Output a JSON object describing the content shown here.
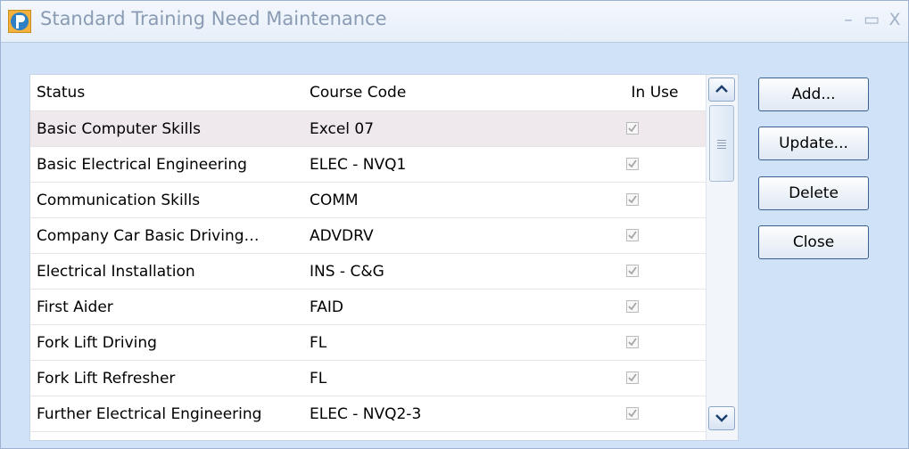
{
  "window": {
    "title": "Standard Training Need Maintenance",
    "icon": "app-logo-icon",
    "controls": [
      "minimize-icon",
      "maximize-icon",
      "close-icon"
    ]
  },
  "table": {
    "columns": {
      "status": "Status",
      "code": "Course Code",
      "inuse": "In Use"
    },
    "rows": [
      {
        "status": "Basic Computer Skills",
        "code": "Excel 07",
        "in_use": true
      },
      {
        "status": "Basic Electrical Engineering",
        "code": "ELEC - NVQ1",
        "in_use": true
      },
      {
        "status": "Communication Skills",
        "code": "COMM",
        "in_use": true
      },
      {
        "status": "Company Car Basic Driving…",
        "code": "ADVDRV",
        "in_use": true
      },
      {
        "status": "Electrical Installation",
        "code": "INS - C&G",
        "in_use": true
      },
      {
        "status": "First Aider",
        "code": "FAID",
        "in_use": true
      },
      {
        "status": "Fork Lift Driving",
        "code": "FL",
        "in_use": true
      },
      {
        "status": "Fork Lift Refresher",
        "code": "FL",
        "in_use": true
      },
      {
        "status": "Further Electrical Engineering",
        "code": "ELEC - NVQ2-3",
        "in_use": true
      }
    ],
    "selected_row": 0
  },
  "buttons": {
    "add": "Add...",
    "update": "Update...",
    "delete": "Delete",
    "close": "Close"
  },
  "colors": {
    "window_bg": "#cfe2f8",
    "selected_row": "#efe9ee",
    "button_border": "#3b5f8f"
  }
}
